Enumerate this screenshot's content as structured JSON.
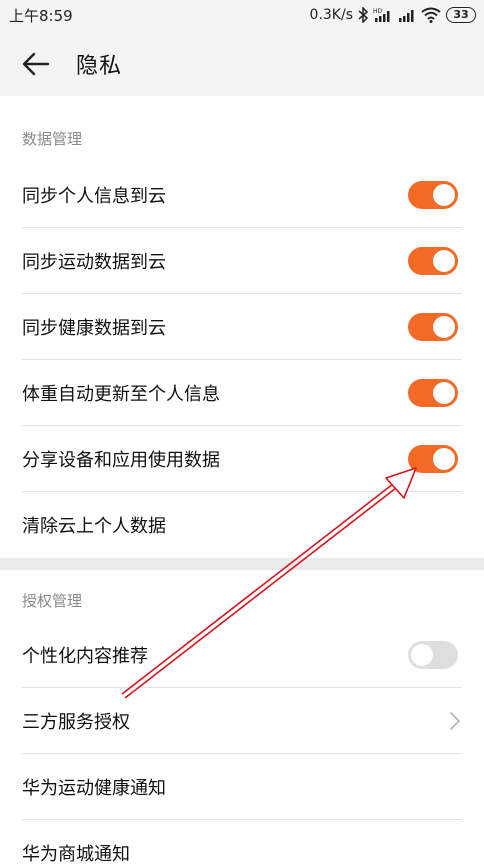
{
  "status_bar": {
    "time": "上午8:59",
    "network_speed": "0.3K/s",
    "battery_level": "33",
    "icons": [
      "bluetooth-icon",
      "hd-signal-icon",
      "signal-icon",
      "wifi-icon",
      "battery-icon"
    ]
  },
  "header": {
    "back_icon": "arrow-left-icon",
    "title": "隐私"
  },
  "data_management": {
    "heading": "数据管理",
    "items": [
      {
        "label": "同步个人信息到云",
        "toggle": "on"
      },
      {
        "label": "同步运动数据到云",
        "toggle": "on"
      },
      {
        "label": "同步健康数据到云",
        "toggle": "on"
      },
      {
        "label": "体重自动更新至个人信息",
        "toggle": "on"
      },
      {
        "label": "分享设备和应用使用数据",
        "toggle": "on"
      },
      {
        "label": "清除云上个人数据"
      }
    ]
  },
  "authorization_management": {
    "heading": "授权管理",
    "items": [
      {
        "label": "个性化内容推荐",
        "toggle": "off"
      },
      {
        "label": "三方服务授权",
        "icon": "chevron-right-icon"
      },
      {
        "label": "华为运动健康通知"
      },
      {
        "label": "华为商城通知"
      }
    ]
  },
  "colors": {
    "toggle_on": "#f26a26",
    "toggle_off": "#dedede",
    "annotation_arrow": "#d9121b"
  }
}
